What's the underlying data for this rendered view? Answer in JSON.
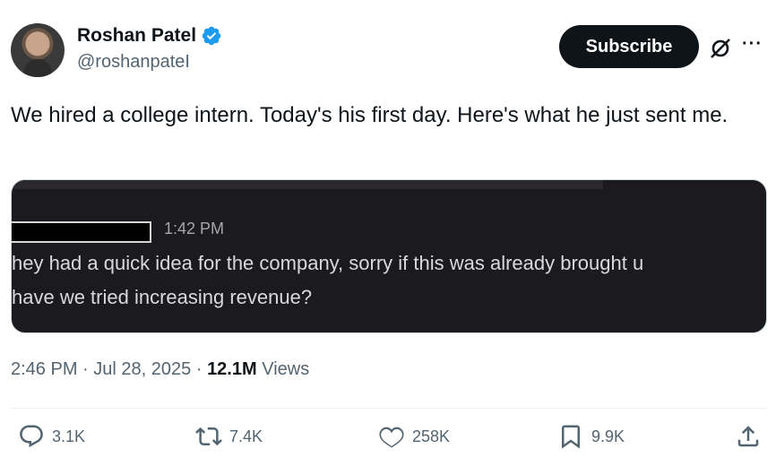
{
  "author": {
    "name": "Roshan Patel",
    "handle": "@roshanpateI",
    "verified_color": "#1d9bf0"
  },
  "header": {
    "subscribe_label": "Subscribe",
    "icons": [
      "grok-icon",
      "more-icon"
    ]
  },
  "tweet": {
    "text": "We hired a college intern. Today's his first day. Here's what he just sent me."
  },
  "media": {
    "time": "1:42 PM",
    "line1": "hey had a quick idea for the company, sorry if this was already brought u",
    "line2": "have we tried increasing revenue?"
  },
  "meta": {
    "time": "2:46 PM",
    "separator": "·",
    "date": "Jul 28, 2025",
    "views_count": "12.1M",
    "views_label": "Views"
  },
  "actions": {
    "reply_count": "3.1K",
    "repost_count": "7.4K",
    "like_count": "258K",
    "bookmark_count": "9.9K"
  },
  "colors": {
    "text": "#0f1419",
    "secondary": "#536471",
    "button_bg": "#0f1419",
    "media_bg": "#1b1b1d"
  }
}
